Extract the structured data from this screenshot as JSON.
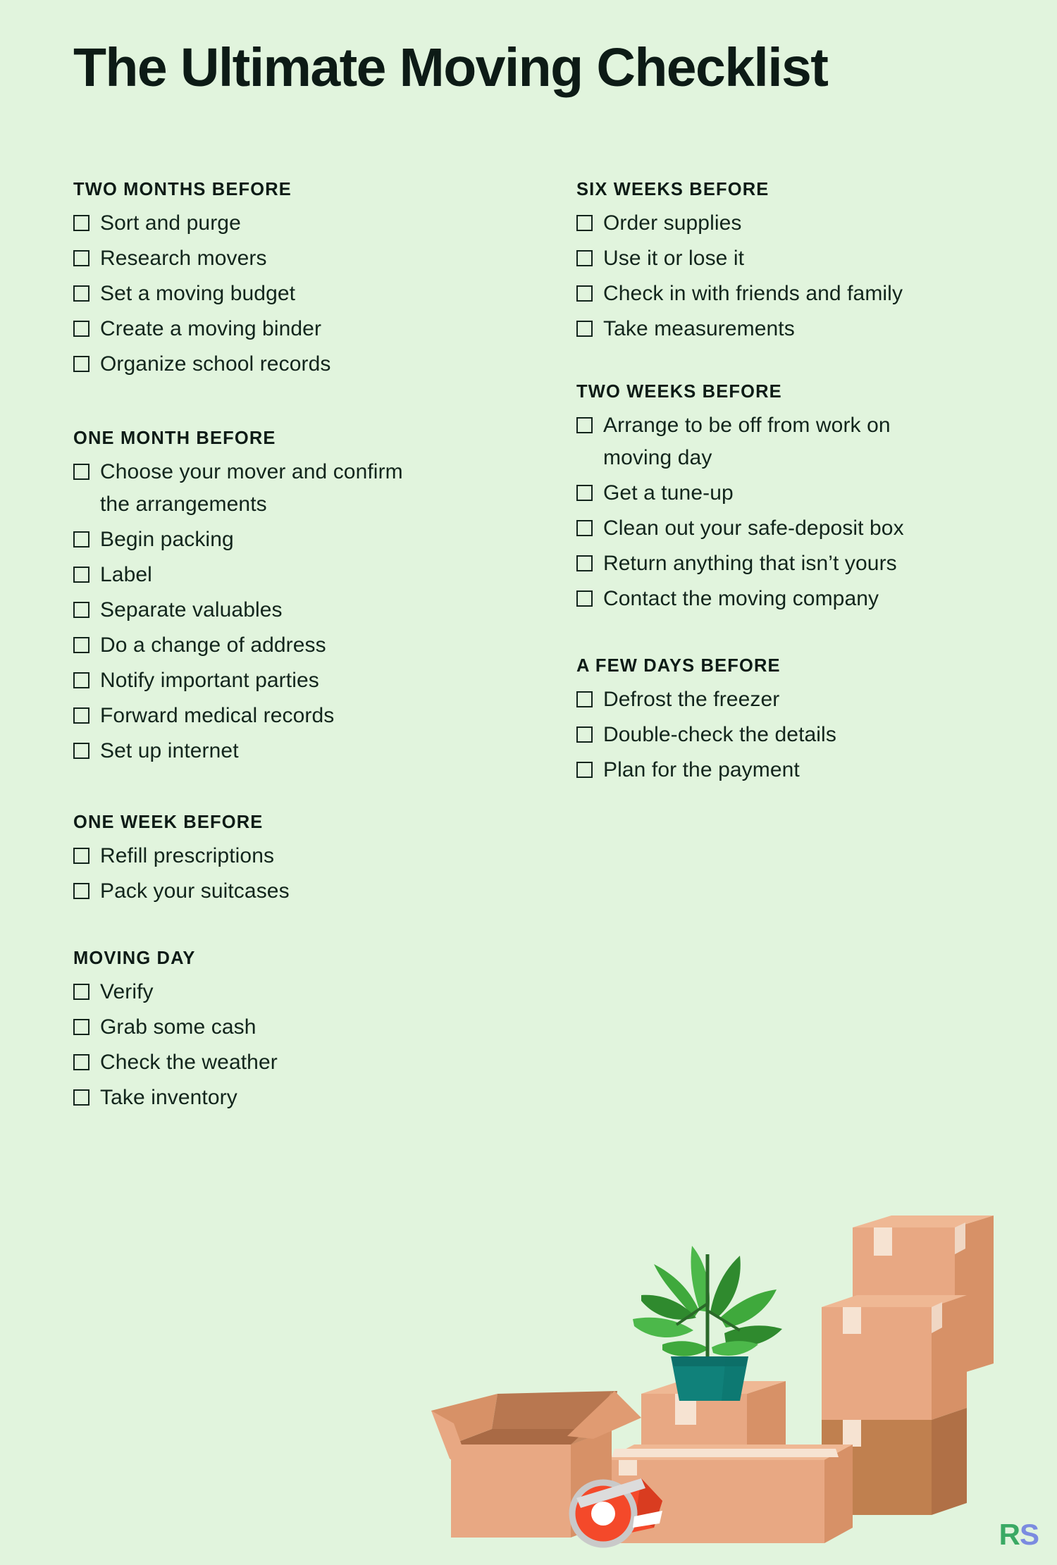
{
  "page": {
    "background_color": "#e1f4dd",
    "text_color": "#12251c",
    "title": "The Ultimate Moving Checklist"
  },
  "logo": {
    "first": "R",
    "second": "S",
    "first_color": "#3aa964",
    "second_color": "#7b8be0"
  },
  "columns": {
    "left": [
      {
        "heading": "TWO MONTHS BEFORE",
        "items": [
          "Sort and purge",
          "Research movers",
          "Set a moving budget",
          "Create a moving binder",
          "Organize school records"
        ]
      },
      {
        "heading": "ONE MONTH BEFORE",
        "items": [
          "Choose your mover and confirm the arrangements",
          "Begin packing",
          "Label",
          "Separate valuables",
          "Do a change of address",
          "Notify important parties",
          "Forward medical records",
          "Set up internet"
        ]
      },
      {
        "heading": "ONE WEEK BEFORE",
        "items": [
          "Refill prescriptions",
          "Pack your suitcases"
        ]
      },
      {
        "heading": "MOVING DAY",
        "items": [
          "Verify",
          "Grab some cash",
          "Check the weather",
          "Take inventory"
        ]
      }
    ],
    "right": [
      {
        "heading": "SIX WEEKS BEFORE",
        "items": [
          "Order supplies",
          "Use it or lose it",
          "Check in with friends and family",
          "Take measurements"
        ]
      },
      {
        "heading": "TWO WEEKS BEFORE",
        "items": [
          "Arrange to be off from work on moving day",
          "Get a tune-up",
          "Clean out your safe-deposit box",
          "Return anything that isn’t yours",
          "Contact the moving company"
        ]
      },
      {
        "heading": "A FEW DAYS BEFORE",
        "items": [
          "Defrost the freezer",
          "Double-check the details",
          "Plan for the payment"
        ]
      }
    ]
  },
  "illustration": {
    "name": "moving-boxes-illustration",
    "elements": [
      "potted-plant",
      "cardboard-boxes",
      "open-box",
      "tape-dispenser"
    ],
    "colors": {
      "box_light": "#e8a883",
      "box_mid": "#d79167",
      "box_dark": "#b87750",
      "box_inner": "#a96a45",
      "tape_strip": "#f6e3d2",
      "plant_pot": "#10817a",
      "plant_leaf": "#3fa93c",
      "plant_leaf_dark": "#2f8a2e",
      "dispenser": "#f4492a",
      "roll": "#c9c9c9"
    }
  }
}
